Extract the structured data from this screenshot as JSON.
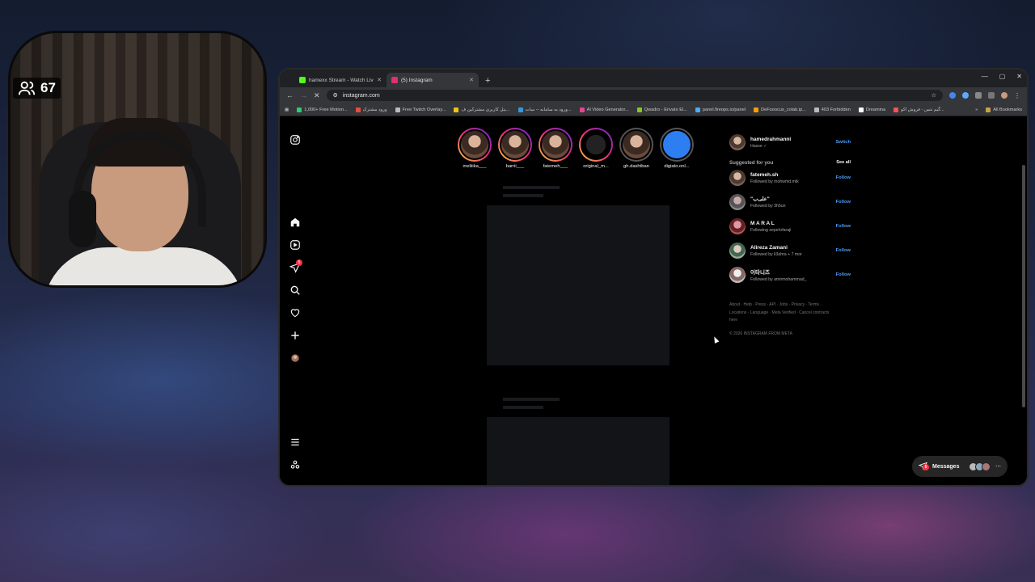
{
  "stream": {
    "viewer_count": "67"
  },
  "browser": {
    "tabs": [
      {
        "title": "hamexx Stream - Watch Live on",
        "color": "#53fc18",
        "active": false
      },
      {
        "title": "(5) Instagram",
        "color": "#e1306c",
        "active": true
      }
    ],
    "url": "instagram.com",
    "bookmarks": [
      {
        "label": "1,000+ Free Motion...",
        "color": "#2ecc71"
      },
      {
        "label": "ورود مشترک",
        "color": "#e74c3c"
      },
      {
        "label": "Free Twitch Overlay...",
        "color": "#bbbbbb"
      },
      {
        "label": "پنل کاربری مشترکین ف...",
        "color": "#f1c40f"
      },
      {
        "label": "ورود به سامانه -- سات...",
        "color": "#3498db"
      },
      {
        "label": "AI Video Generator...",
        "color": "#e84393"
      },
      {
        "label": "Qwadro - Envato El...",
        "color": "#82c91e"
      },
      {
        "label": "panel.fireops.io/panel",
        "color": "#4dabf7"
      },
      {
        "label": "DeFooocus_colab.ip...",
        "color": "#f59f00"
      },
      {
        "label": "403 Forbidden",
        "color": "#bbbbbb"
      },
      {
        "label": "Dreamina",
        "color": "#ffffff"
      },
      {
        "label": "گیم نتس - فروش اکو...",
        "color": "#fa5252"
      }
    ],
    "all_bookmarks": "All Bookmarks"
  },
  "instagram": {
    "nav_badge": "5",
    "stories": [
      {
        "name": "meliiika___",
        "seen": false
      },
      {
        "name": "barrii___",
        "seen": false
      },
      {
        "name": "fatemeh___",
        "seen": false
      },
      {
        "name": "original_m...",
        "seen": false
      },
      {
        "name": "gh.dashtban",
        "seen": true
      },
      {
        "name": "digiato.onl...",
        "seen": true
      }
    ],
    "me": {
      "username": "hamedrahmanni",
      "subtitle": "Hasse ✓",
      "action": "Switch"
    },
    "suggested_title": "Suggested for you",
    "see_all": "See all",
    "suggestions": [
      {
        "username": "fatemeh.sh",
        "subtitle": "Followed by mohwmd.mlk",
        "action": "Follow"
      },
      {
        "username": "\"علی‌ب\"",
        "subtitle": "Followed by 3h5un",
        "action": "Follow"
      },
      {
        "username": "M A R A L",
        "subtitle": "Following sepehrfaraji",
        "action": "Follow"
      },
      {
        "username": "Alireza Zamani",
        "subtitle": "Followed by li3ahra + 7 mor",
        "action": "Follow"
      },
      {
        "username": "이타니즈",
        "subtitle": "Followed by amirmohammad_",
        "action": "Follow"
      }
    ],
    "footer": "About · Help · Press · API · Jobs · Privacy · Terms · Locations · Language · Meta Verified · Cancel contracts here",
    "copyright": "© 2026 INSTAGRAM FROM META",
    "messages_label": "Messages",
    "messages_badge": "5"
  }
}
